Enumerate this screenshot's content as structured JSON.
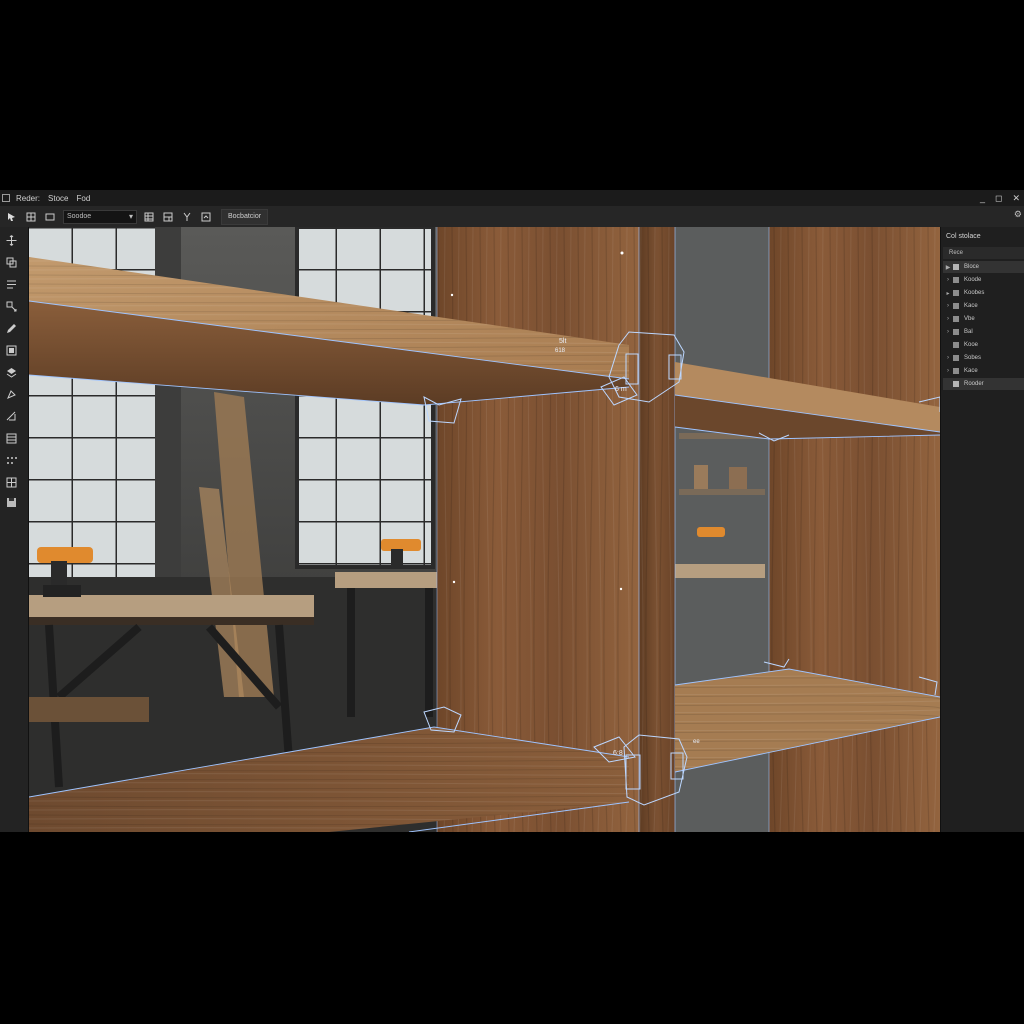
{
  "menu": [
    "Reder:",
    "Stoce",
    "Fod"
  ],
  "window_controls": [
    "_",
    "◻",
    "✕"
  ],
  "toolbar": {
    "field_value": "Soodoe",
    "label": "Bocbatcior",
    "icons": [
      "select-arrow-icon",
      "grid-icon",
      "field-icon",
      "view-grid-icon",
      "view-split-icon",
      "fork-icon",
      "view-frame-icon"
    ]
  },
  "tools": [
    "move-icon",
    "copy-icon",
    "list-icon",
    "transform-icon",
    "pencil-icon",
    "frame-icon",
    "layers-icon",
    "shape-icon",
    "measure-icon",
    "table-icon",
    "dots-icon",
    "box-icon",
    "save-icon"
  ],
  "panel": {
    "title": "Col stolace",
    "header": "Rece",
    "items": [
      {
        "label": "Bloce",
        "selected": true
      },
      {
        "label": "Koode"
      },
      {
        "label": "Koobes"
      },
      {
        "label": "Kace"
      },
      {
        "label": "Vbe"
      },
      {
        "label": "Bal"
      },
      {
        "label": "Kooe"
      },
      {
        "label": "Sobes"
      },
      {
        "label": "Kace"
      },
      {
        "label": "Rooder",
        "selected": true
      }
    ]
  },
  "annotations": {
    "top_joint": "5lt",
    "top_joint_small": "618",
    "mid_joint": "6 m",
    "bottom_joint": "6:8",
    "bottom_joint_small": "ee"
  },
  "colors": {
    "wood_light": "#b48a5f",
    "wood_dark": "#7a4f31",
    "wire": "#9fc4ff",
    "tool_orange": "#e08a2e"
  }
}
